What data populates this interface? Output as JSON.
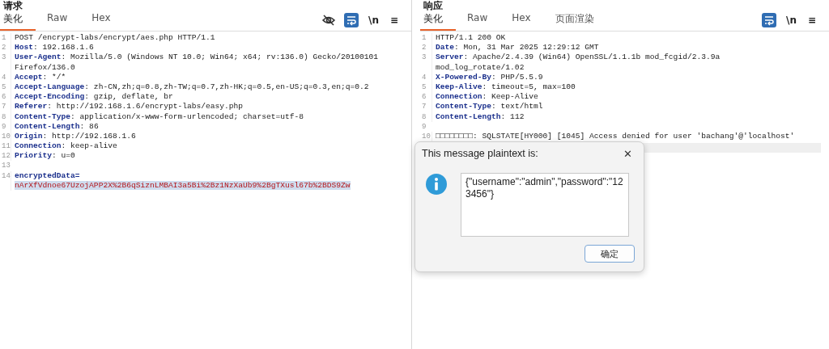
{
  "panels": [
    {
      "title": "请求",
      "tabs": [
        {
          "label": "美化",
          "selected": true
        },
        {
          "label": "Raw",
          "selected": false
        },
        {
          "label": "Hex",
          "selected": false
        }
      ],
      "tools": [
        {
          "kind": "hide",
          "selected": false
        },
        {
          "kind": "wrap",
          "selected": true
        },
        {
          "kind": "text",
          "label": "\\n",
          "selected": false
        },
        {
          "kind": "menu",
          "label": "≡",
          "selected": false
        }
      ],
      "lines": [
        {
          "number": "1",
          "parts": [
            {
              "kind": "plain",
              "text": "POST /encrypt-labs/encrypt/aes.php HTTP/1.1"
            }
          ]
        },
        {
          "number": "2",
          "parts": [
            {
              "kind": "key",
              "text": "Host"
            },
            {
              "kind": "plain",
              "text": ": 192.168.1.6"
            }
          ]
        },
        {
          "number": "3",
          "parts": [
            {
              "kind": "key",
              "text": "User-Agent"
            },
            {
              "kind": "plain",
              "text": ": Mozilla/5.0 (Windows NT 10.0; Win64; x64; rv:136.0) Gecko/20100101"
            }
          ]
        },
        {
          "parts": [
            {
              "kind": "plain",
              "text": "Firefox/136.0"
            }
          ]
        },
        {
          "number": "4",
          "parts": [
            {
              "kind": "key",
              "text": "Accept"
            },
            {
              "kind": "plain",
              "text": ": */*"
            }
          ]
        },
        {
          "number": "5",
          "parts": [
            {
              "kind": "key",
              "text": "Accept-Language"
            },
            {
              "kind": "plain",
              "text": ": zh-CN,zh;q=0.8,zh-TW;q=0.7,zh-HK;q=0.5,en-US;q=0.3,en;q=0.2"
            }
          ]
        },
        {
          "number": "6",
          "parts": [
            {
              "kind": "key",
              "text": "Accept-Encoding"
            },
            {
              "kind": "plain",
              "text": ": gzip, deflate, br"
            }
          ]
        },
        {
          "number": "7",
          "parts": [
            {
              "kind": "key",
              "text": "Referer"
            },
            {
              "kind": "plain",
              "text": ": http://192.168.1.6/encrypt-labs/easy.php"
            }
          ]
        },
        {
          "number": "8",
          "parts": [
            {
              "kind": "key",
              "text": "Content-Type"
            },
            {
              "kind": "plain",
              "text": ": application/x-www-form-urlencoded; charset=utf-8"
            }
          ]
        },
        {
          "number": "9",
          "parts": [
            {
              "kind": "key",
              "text": "Content-Length"
            },
            {
              "kind": "plain",
              "text": ": 86"
            }
          ]
        },
        {
          "number": "10",
          "parts": [
            {
              "kind": "key",
              "text": "Origin"
            },
            {
              "kind": "plain",
              "text": ": http://192.168.1.6"
            }
          ]
        },
        {
          "number": "11",
          "parts": [
            {
              "kind": "key",
              "text": "Connection"
            },
            {
              "kind": "plain",
              "text": ": keep-alive"
            }
          ]
        },
        {
          "number": "12",
          "parts": [
            {
              "kind": "key",
              "text": "Priority"
            },
            {
              "kind": "plain",
              "text": ": u=0"
            }
          ]
        },
        {
          "number": "13"
        },
        {
          "number": "14",
          "parts": [
            {
              "kind": "key",
              "text": "encryptedData="
            }
          ]
        },
        {
          "parts": [
            {
              "kind": "selected_value",
              "text": "nArXfVdnoe67UzojAPP2X%2B6qSiznLMBAI3a5Bi%2Bz1NzXaUb9%2BgTXusl67b%2BDS9Zw"
            }
          ]
        }
      ]
    },
    {
      "title": "响应",
      "tabs": [
        {
          "label": "美化",
          "selected": true
        },
        {
          "label": "Raw",
          "selected": false
        },
        {
          "label": "Hex",
          "selected": false
        },
        {
          "label": "页面渲染",
          "selected": false
        }
      ],
      "tools": [
        {
          "kind": "wrap",
          "selected": true
        },
        {
          "kind": "text",
          "label": "\\n",
          "selected": false
        },
        {
          "kind": "menu",
          "label": "≡",
          "selected": false
        }
      ],
      "lines": [
        {
          "number": "1",
          "parts": [
            {
              "kind": "plain",
              "text": "HTTP/1.1 200 OK"
            }
          ]
        },
        {
          "number": "2",
          "parts": [
            {
              "kind": "key",
              "text": "Date"
            },
            {
              "kind": "plain",
              "text": ": Mon, 31 Mar 2025 12:29:12 GMT"
            }
          ]
        },
        {
          "number": "3",
          "parts": [
            {
              "kind": "key",
              "text": "Server"
            },
            {
              "kind": "plain",
              "text": ": Apache/2.4.39 (Win64) OpenSSL/1.1.1b mod_fcgid/2.3.9a"
            }
          ]
        },
        {
          "parts": [
            {
              "kind": "plain",
              "text": "mod_log_rotate/1.02"
            }
          ]
        },
        {
          "number": "4",
          "parts": [
            {
              "kind": "key",
              "text": "X-Powered-By"
            },
            {
              "kind": "plain",
              "text": ": PHP/5.5.9"
            }
          ]
        },
        {
          "number": "5",
          "parts": [
            {
              "kind": "key",
              "text": "Keep-Alive"
            },
            {
              "kind": "plain",
              "text": ": timeout=5, max=100"
            }
          ]
        },
        {
          "number": "6",
          "parts": [
            {
              "kind": "key",
              "text": "Connection"
            },
            {
              "kind": "plain",
              "text": ": Keep-Alive"
            }
          ]
        },
        {
          "number": "7",
          "parts": [
            {
              "kind": "key",
              "text": "Content-Type"
            },
            {
              "kind": "plain",
              "text": ": text/html"
            }
          ]
        },
        {
          "number": "8",
          "parts": [
            {
              "kind": "key",
              "text": "Content-Length"
            },
            {
              "kind": "plain",
              "text": ": 112"
            }
          ]
        },
        {
          "number": "9"
        },
        {
          "number": "10",
          "parts": [
            {
              "kind": "plain",
              "text": "□□□□□□□□: SQLSTATE[HY000] [1045] Access denied for user 'bachang'@'localhost'"
            }
          ]
        }
      ]
    }
  ],
  "dialog": {
    "title": "This message plaintext is:",
    "close": "✕",
    "message": "{\"username\":\"admin\",\"password\":\"123456\"}",
    "button": "确定"
  }
}
